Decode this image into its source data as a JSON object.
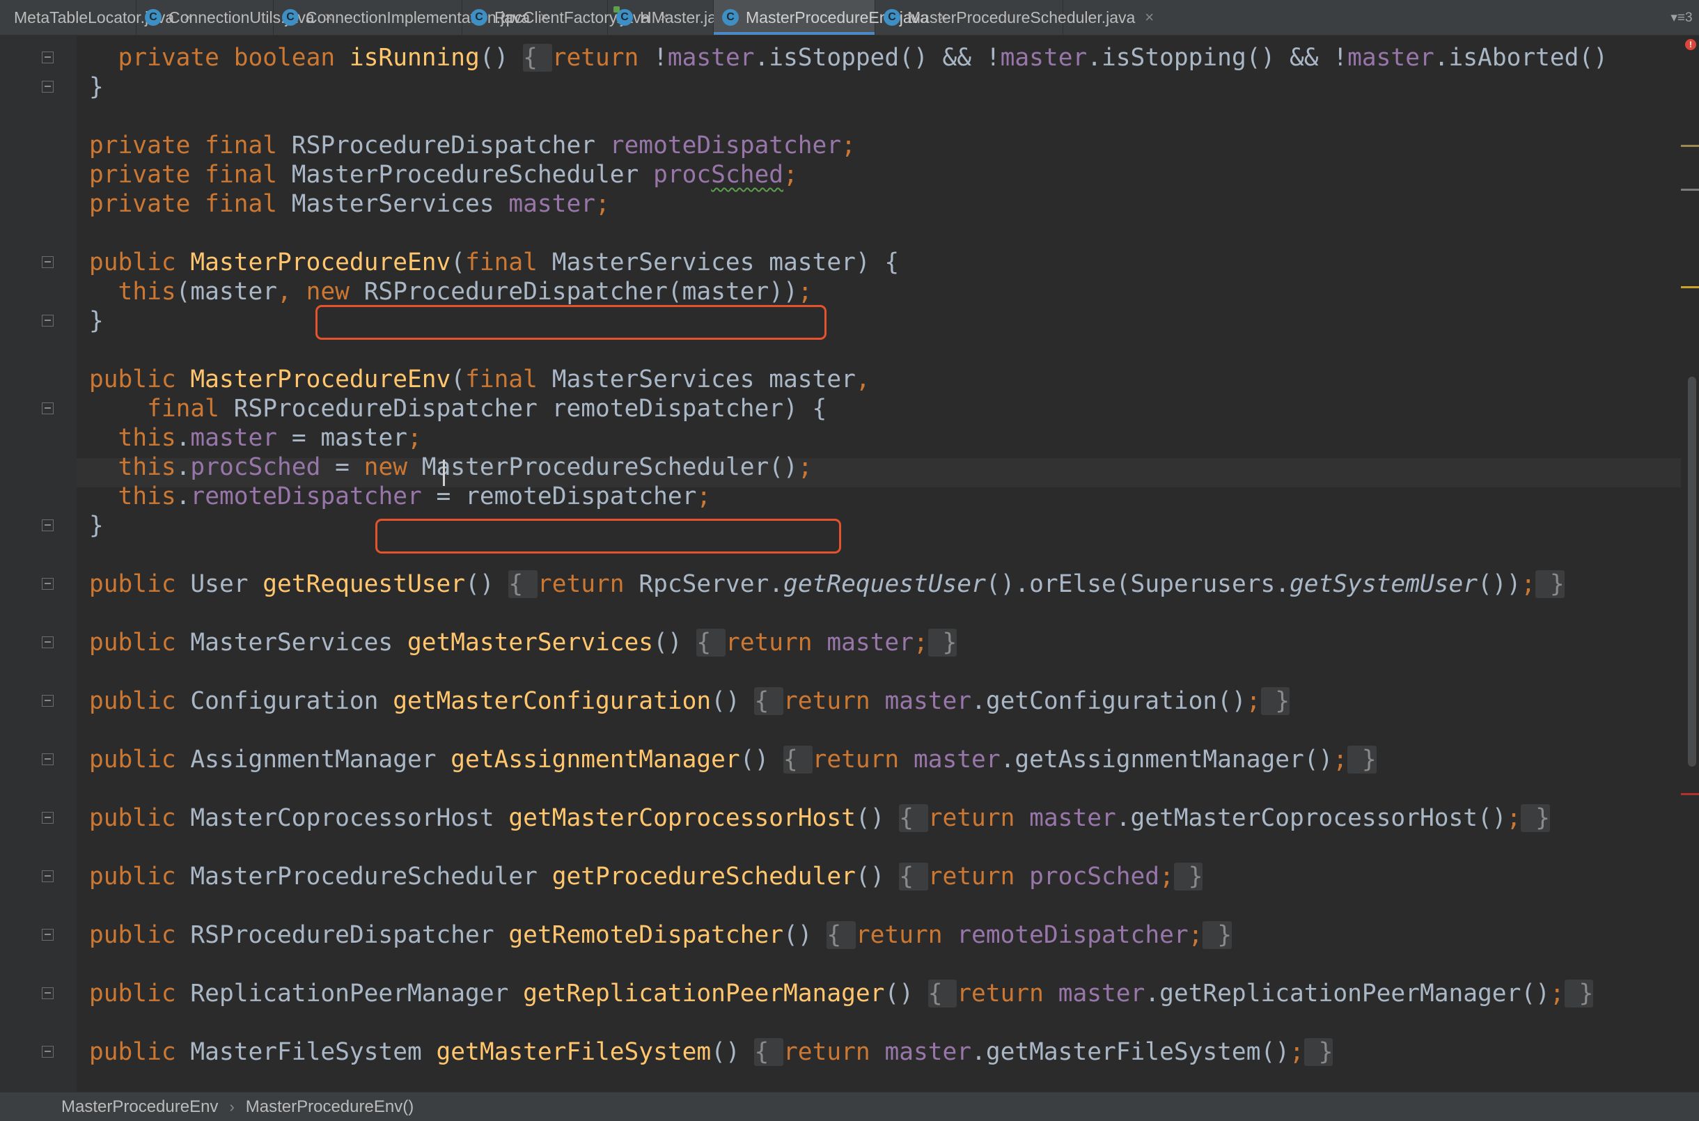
{
  "tabs": [
    {
      "label": "MetaTableLocator.java",
      "close": "×",
      "active": false,
      "icon": "class-icon"
    },
    {
      "label": "ConnectionUtils.java",
      "close": "×",
      "active": false,
      "icon": "class-icon"
    },
    {
      "label": "ConnectionImplementation.java",
      "close": "×",
      "active": false,
      "icon": "class-icon"
    },
    {
      "label": "RpcClientFactory.java",
      "close": "×",
      "active": false,
      "icon": "class-icon"
    },
    {
      "label": "HMaster.java",
      "close": "×",
      "active": false,
      "icon": "runnable-class-icon"
    },
    {
      "label": "MasterProcedureEnv.java",
      "close": "×",
      "active": true,
      "icon": "class-icon"
    },
    {
      "label": "MasterProcedureScheduler.java",
      "close": "×",
      "active": false,
      "icon": "class-icon"
    }
  ],
  "tab_overflow_label": "▾≡3",
  "code_lines": [
    [
      {
        "t": "  "
      },
      {
        "t": "private ",
        "c": "kw"
      },
      {
        "t": "boolean ",
        "c": "kw"
      },
      {
        "t": "isRunning",
        "c": "fn"
      },
      {
        "t": "() "
      },
      {
        "t": "{ ",
        "c": "fb"
      },
      {
        "t": "return ",
        "c": "kw"
      },
      {
        "t": "!"
      },
      {
        "t": "master",
        "c": "fd"
      },
      {
        "t": ".isStopped() && !"
      },
      {
        "t": "master",
        "c": "fd"
      },
      {
        "t": ".isStopping() && !"
      },
      {
        "t": "master",
        "c": "fd"
      },
      {
        "t": ".isAborted()"
      }
    ],
    [
      {
        "t": "}"
      }
    ],
    [
      {
        "t": ""
      }
    ],
    [
      {
        "t": "private ",
        "c": "kw"
      },
      {
        "t": "final ",
        "c": "kw"
      },
      {
        "t": "RSProcedureDispatcher "
      },
      {
        "t": "remoteDispatcher",
        "c": "fd"
      },
      {
        "t": ";",
        "c": "kw"
      }
    ],
    [
      {
        "t": "private ",
        "c": "kw"
      },
      {
        "t": "final ",
        "c": "kw"
      },
      {
        "t": "MasterProcedureScheduler "
      },
      {
        "t": "proc",
        "c": "fd"
      },
      {
        "t": "Sched",
        "c": "fd squig"
      },
      {
        "t": ";",
        "c": "kw"
      }
    ],
    [
      {
        "t": "private ",
        "c": "kw"
      },
      {
        "t": "final ",
        "c": "kw"
      },
      {
        "t": "MasterServices "
      },
      {
        "t": "master",
        "c": "fd"
      },
      {
        "t": ";",
        "c": "kw"
      }
    ],
    [
      {
        "t": ""
      }
    ],
    [
      {
        "t": "public ",
        "c": "kw"
      },
      {
        "t": "MasterProcedureEnv",
        "c": "fn"
      },
      {
        "t": "("
      },
      {
        "t": "final ",
        "c": "kw"
      },
      {
        "t": "MasterServices master) {"
      }
    ],
    [
      {
        "t": "  "
      },
      {
        "t": "this",
        "c": "kw"
      },
      {
        "t": "(master"
      },
      {
        "t": ", ",
        "c": "kw"
      },
      {
        "t": "new ",
        "c": "kw"
      },
      {
        "t": "RSProcedureDispatcher(master))"
      },
      {
        "t": ";",
        "c": "kw"
      }
    ],
    [
      {
        "t": "}"
      }
    ],
    [
      {
        "t": ""
      }
    ],
    [
      {
        "t": "public ",
        "c": "kw"
      },
      {
        "t": "MasterProcedureEnv",
        "c": "fn"
      },
      {
        "t": "("
      },
      {
        "t": "final ",
        "c": "kw"
      },
      {
        "t": "MasterServices master"
      },
      {
        "t": ",",
        "c": "kw"
      }
    ],
    [
      {
        "t": "    "
      },
      {
        "t": "final ",
        "c": "kw"
      },
      {
        "t": "RSProcedureDispatcher remoteDispatcher) {"
      }
    ],
    [
      {
        "t": "  "
      },
      {
        "t": "this",
        "c": "kw"
      },
      {
        "t": "."
      },
      {
        "t": "master",
        "c": "fd"
      },
      {
        "t": " = master"
      },
      {
        "t": ";",
        "c": "kw"
      }
    ],
    [
      {
        "t": "  "
      },
      {
        "t": "this",
        "c": "kw"
      },
      {
        "t": "."
      },
      {
        "t": "procSched",
        "c": "fd"
      },
      {
        "t": " = "
      },
      {
        "t": "new ",
        "c": "kw"
      },
      {
        "t": "MasterProcedureScheduler()"
      },
      {
        "t": ";",
        "c": "kw"
      }
    ],
    [
      {
        "t": "  "
      },
      {
        "t": "this",
        "c": "kw"
      },
      {
        "t": "."
      },
      {
        "t": "remoteDispatcher",
        "c": "fd"
      },
      {
        "t": " = remoteDispatcher"
      },
      {
        "t": ";",
        "c": "kw"
      }
    ],
    [
      {
        "t": "}"
      }
    ],
    [
      {
        "t": ""
      }
    ],
    [
      {
        "t": "public ",
        "c": "kw"
      },
      {
        "t": "User "
      },
      {
        "t": "getRequestUser",
        "c": "fn"
      },
      {
        "t": "() "
      },
      {
        "t": "{ ",
        "c": "fb"
      },
      {
        "t": "return ",
        "c": "kw"
      },
      {
        "t": "RpcServer."
      },
      {
        "t": "getRequestUser",
        "c": "it"
      },
      {
        "t": "().orElse(Superusers."
      },
      {
        "t": "getSystemUser",
        "c": "it"
      },
      {
        "t": "())"
      },
      {
        "t": ";",
        "c": "kw"
      },
      {
        "t": " }",
        "c": "fb"
      }
    ],
    [
      {
        "t": ""
      }
    ],
    [
      {
        "t": "public ",
        "c": "kw"
      },
      {
        "t": "MasterServices "
      },
      {
        "t": "getMasterServices",
        "c": "fn"
      },
      {
        "t": "() "
      },
      {
        "t": "{ ",
        "c": "fb"
      },
      {
        "t": "return ",
        "c": "kw"
      },
      {
        "t": "master",
        "c": "fd"
      },
      {
        "t": ";",
        "c": "kw"
      },
      {
        "t": " }",
        "c": "fb"
      }
    ],
    [
      {
        "t": ""
      }
    ],
    [
      {
        "t": "public ",
        "c": "kw"
      },
      {
        "t": "Configuration "
      },
      {
        "t": "getMasterConfiguration",
        "c": "fn"
      },
      {
        "t": "() "
      },
      {
        "t": "{ ",
        "c": "fb"
      },
      {
        "t": "return ",
        "c": "kw"
      },
      {
        "t": "master",
        "c": "fd"
      },
      {
        "t": ".getConfiguration()"
      },
      {
        "t": ";",
        "c": "kw"
      },
      {
        "t": " }",
        "c": "fb"
      }
    ],
    [
      {
        "t": ""
      }
    ],
    [
      {
        "t": "public ",
        "c": "kw"
      },
      {
        "t": "AssignmentManager "
      },
      {
        "t": "getAssignmentManager",
        "c": "fn"
      },
      {
        "t": "() "
      },
      {
        "t": "{ ",
        "c": "fb"
      },
      {
        "t": "return ",
        "c": "kw"
      },
      {
        "t": "master",
        "c": "fd"
      },
      {
        "t": ".getAssignmentManager()"
      },
      {
        "t": ";",
        "c": "kw"
      },
      {
        "t": " }",
        "c": "fb"
      }
    ],
    [
      {
        "t": ""
      }
    ],
    [
      {
        "t": "public ",
        "c": "kw"
      },
      {
        "t": "MasterCoprocessorHost "
      },
      {
        "t": "getMasterCoprocessorHost",
        "c": "fn"
      },
      {
        "t": "() "
      },
      {
        "t": "{ ",
        "c": "fb"
      },
      {
        "t": "return ",
        "c": "kw"
      },
      {
        "t": "master",
        "c": "fd"
      },
      {
        "t": ".getMasterCoprocessorHost()"
      },
      {
        "t": ";",
        "c": "kw"
      },
      {
        "t": " }",
        "c": "fb"
      }
    ],
    [
      {
        "t": ""
      }
    ],
    [
      {
        "t": "public ",
        "c": "kw"
      },
      {
        "t": "MasterProcedureScheduler "
      },
      {
        "t": "getProcedureScheduler",
        "c": "fn"
      },
      {
        "t": "() "
      },
      {
        "t": "{ ",
        "c": "fb"
      },
      {
        "t": "return ",
        "c": "kw"
      },
      {
        "t": "procSched",
        "c": "fd"
      },
      {
        "t": ";",
        "c": "kw"
      },
      {
        "t": " }",
        "c": "fb"
      }
    ],
    [
      {
        "t": ""
      }
    ],
    [
      {
        "t": "public ",
        "c": "kw"
      },
      {
        "t": "RSProcedureDispatcher "
      },
      {
        "t": "getRemoteDispatcher",
        "c": "fn"
      },
      {
        "t": "() "
      },
      {
        "t": "{ ",
        "c": "fb"
      },
      {
        "t": "return ",
        "c": "kw"
      },
      {
        "t": "remoteDispatcher",
        "c": "fd"
      },
      {
        "t": ";",
        "c": "kw"
      },
      {
        "t": " }",
        "c": "fb"
      }
    ],
    [
      {
        "t": ""
      }
    ],
    [
      {
        "t": "public ",
        "c": "kw"
      },
      {
        "t": "ReplicationPeerManager "
      },
      {
        "t": "getReplicationPeerManager",
        "c": "fn"
      },
      {
        "t": "() "
      },
      {
        "t": "{ ",
        "c": "fb"
      },
      {
        "t": "return ",
        "c": "kw"
      },
      {
        "t": "master",
        "c": "fd"
      },
      {
        "t": ".getReplicationPeerManager()"
      },
      {
        "t": ";",
        "c": "kw"
      },
      {
        "t": " }",
        "c": "fb"
      }
    ],
    [
      {
        "t": ""
      }
    ],
    [
      {
        "t": "public ",
        "c": "kw"
      },
      {
        "t": "MasterFileSystem "
      },
      {
        "t": "getMasterFileSystem",
        "c": "fn"
      },
      {
        "t": "() "
      },
      {
        "t": "{ ",
        "c": "fb"
      },
      {
        "t": "return ",
        "c": "kw"
      },
      {
        "t": "master",
        "c": "fd"
      },
      {
        "t": ".getMasterFileSystem()"
      },
      {
        "t": ";",
        "c": "kw"
      },
      {
        "t": " }",
        "c": "fb"
      }
    ]
  ],
  "breadcrumb": [
    "MasterProcedureEnv",
    "MasterProcedureEnv()"
  ],
  "breadcrumb_separator": "›",
  "colors": {
    "keyword": "#cc7832",
    "method": "#ffc66d",
    "field": "#9876aa",
    "default": "#a9b7c6",
    "highlight_box": "#e5532c",
    "background": "#2b2b2b"
  }
}
